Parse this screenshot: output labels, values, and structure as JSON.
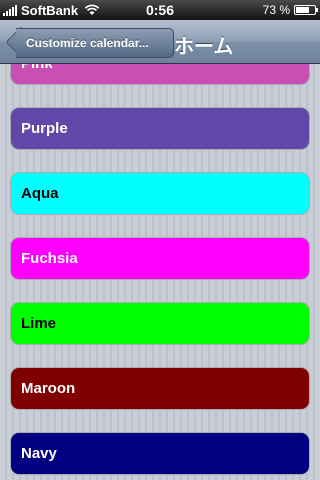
{
  "status_bar": {
    "carrier": "SoftBank",
    "time": "0:56",
    "battery_percent_text": "73 %",
    "battery_level": 0.73
  },
  "nav_bar": {
    "back_label": "Customize calendar...",
    "title": "ホーム"
  },
  "colors": [
    {
      "label": "Pink",
      "bg": "#c94fb4",
      "fg": "#ffffff"
    },
    {
      "label": "Purple",
      "bg": "#6148a8",
      "fg": "#ffffff"
    },
    {
      "label": "Aqua",
      "bg": "#00ffff",
      "fg": "#000000"
    },
    {
      "label": "Fuchsia",
      "bg": "#ff00ff",
      "fg": "#ffffff"
    },
    {
      "label": "Lime",
      "bg": "#00ff00",
      "fg": "#000000"
    },
    {
      "label": "Maroon",
      "bg": "#800000",
      "fg": "#ffffff"
    },
    {
      "label": "Navy",
      "bg": "#000080",
      "fg": "#ffffff"
    }
  ]
}
